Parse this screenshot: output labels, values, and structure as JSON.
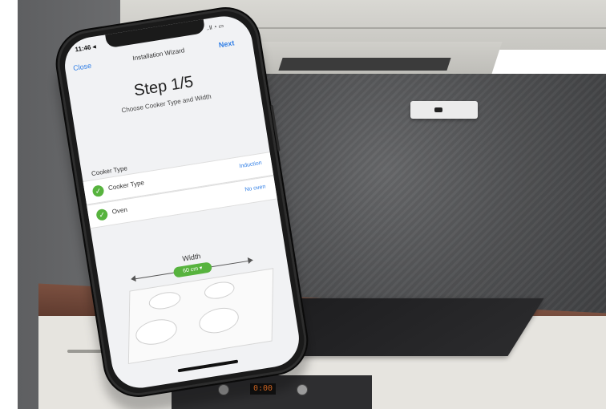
{
  "status_bar": {
    "time": "11:46",
    "time_arrow": "◂",
    "signal": "..ll",
    "wifi": "◔",
    "battery": "▭"
  },
  "navigation": {
    "close_label": "Close",
    "title": "Installation Wizard",
    "next_label": "Next"
  },
  "step": {
    "title": "Step 1/5",
    "subtitle": "Choose Cooker Type and Width"
  },
  "cooker": {
    "section_label": "Cooker Type",
    "rows": [
      {
        "label": "Cooker Type",
        "value": "Induction",
        "icon": "check-circle-icon"
      },
      {
        "label": "Oven",
        "value": "No oven",
        "icon": "check-circle-icon"
      }
    ]
  },
  "width": {
    "label": "Width",
    "value": "60 cm",
    "dropdown_icon": "▾"
  },
  "kitchen": {
    "oven_display": "0:00"
  },
  "colors": {
    "accent_blue": "#2f7ee6",
    "success_green": "#57b33e"
  }
}
